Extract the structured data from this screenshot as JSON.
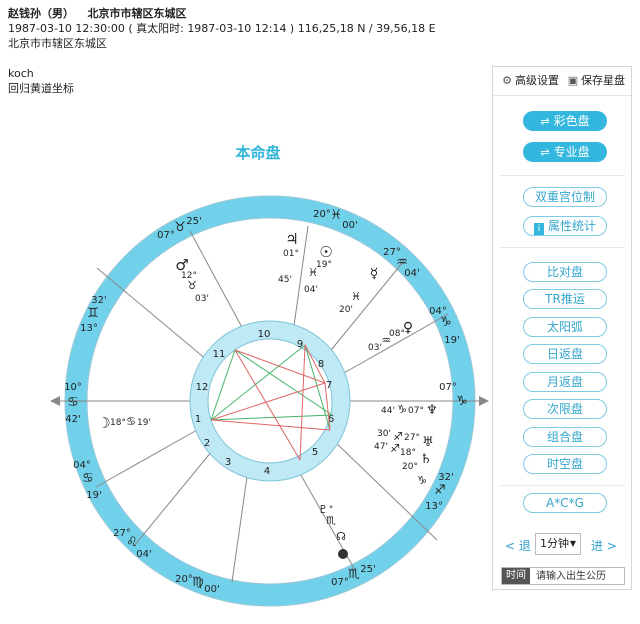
{
  "header": {
    "name": "赵钱孙（男）",
    "location_inline": "北京市市辖区东城区",
    "datetime_line": "1987-03-10 12:30:00 ( 真太阳时: 1987-03-10 12:14 ) 116,25,18 N / 39,56,18 E",
    "location_line": "北京市市辖区东城区"
  },
  "settings": {
    "house_system": "koch",
    "coordinate": "回归黄道坐标"
  },
  "chart_title": "本命盘",
  "colors": {
    "accent": "#34b7de",
    "ring": "#bfe9f4",
    "zodiac_ring": "#72d1ea",
    "aspect_green": "#47b36b",
    "aspect_red": "#e06565",
    "highlight_circle": "#dd1f2b"
  },
  "toolbar": {
    "advanced_label": "高级设置",
    "save_label": "保存星盘"
  },
  "panel": {
    "color_chart_label": "彩色盘",
    "pro_chart_label": "专业盘",
    "dual_house_label": "双重宫位制",
    "attr_stats_label": "属性统计",
    "items": [
      "比对盘",
      "TR推运",
      "太阳弧",
      "日返盘",
      "月返盘",
      "次限盘",
      "组合盘",
      "时空盘"
    ],
    "acg_label": "A*C*G",
    "prev_label": "< 退",
    "next_label": "进 >",
    "step_value": "1分钟",
    "time_label": "时间",
    "time_placeholder": "请输入出生公历"
  },
  "wheel": {
    "signs": [
      {
        "sign": "♓",
        "deg": "20°",
        "min": "00'"
      },
      {
        "sign": "♒",
        "deg": "27°",
        "min": "04'"
      },
      {
        "sign": "♑",
        "deg": "04°",
        "min": "19'"
      },
      {
        "sign": "♑",
        "deg": "07°",
        "min": ""
      },
      {
        "sign": "♐",
        "deg": "32'",
        "min": "13°"
      },
      {
        "sign": "♏",
        "deg": "07°",
        "min": "25'"
      },
      {
        "sign": "♍",
        "deg": "20°",
        "min": "00'"
      },
      {
        "sign": "♌",
        "deg": "27°",
        "min": "04'"
      },
      {
        "sign": "♋",
        "deg": "04°",
        "min": "19'"
      },
      {
        "sign": "♋",
        "deg": "10°",
        "min": "42'"
      },
      {
        "sign": "♊",
        "deg": "32'",
        "min": "13°"
      },
      {
        "sign": "♉",
        "deg": "07°",
        "min": "25'"
      }
    ],
    "houses": [
      "1",
      "2",
      "3",
      "4",
      "5",
      "6",
      "7",
      "8",
      "9",
      "10",
      "11",
      "12"
    ],
    "planets": [
      {
        "glyph": "♃",
        "deg": "01°",
        "min": "45'"
      },
      {
        "glyph": "☉",
        "deg": "19°",
        "min": "04'"
      },
      {
        "glyph": "♀",
        "deg": "08°",
        "min": "03'"
      },
      {
        "glyph": "☿",
        "deg": "",
        "min": "20'"
      },
      {
        "glyph": "♂",
        "deg": "12°",
        "min": "03'"
      },
      {
        "glyph": "☽",
        "deg": "18°",
        "min": "19'"
      },
      {
        "glyph": "♆",
        "deg": "07°",
        "min": "44'"
      },
      {
        "glyph": "♅",
        "deg": "",
        "min": ""
      },
      {
        "glyph": "♇",
        "deg": "",
        "min": ""
      },
      {
        "glyph": "♄",
        "deg": "",
        "min": ""
      }
    ]
  }
}
